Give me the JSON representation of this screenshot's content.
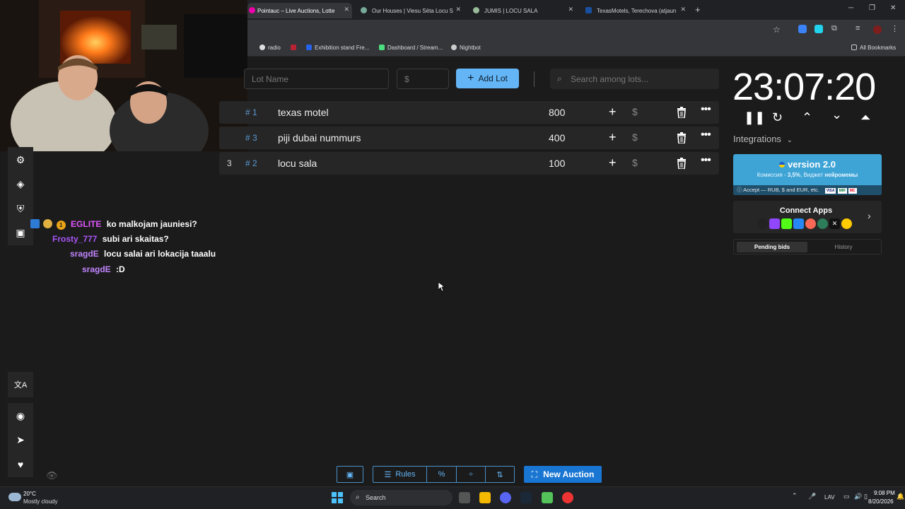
{
  "browser": {
    "tabs": [
      {
        "label": "Pointauc – Live Auctions, Lotte",
        "active": true
      },
      {
        "label": "Our Houses | Viesu Sēta Locu S",
        "active": false
      },
      {
        "label": "JUMIS | LOCU SALA",
        "active": false
      },
      {
        "label": "TexasMotels, Terechova (atjaun",
        "active": false
      }
    ],
    "bookmarks": [
      "radio",
      "Exhibition stand Fre...",
      "Dashboard / Stream...",
      "Nightbot"
    ],
    "all_bookmarks": "All Bookmarks",
    "new_tab": "+",
    "window_controls": {
      "min": "─",
      "max": "❐",
      "close": "✕"
    }
  },
  "lot_form": {
    "name_placeholder": "Lot Name",
    "amount_placeholder": "$",
    "add_label": "Add Lot",
    "search_placeholder": "Search among lots..."
  },
  "lots": [
    {
      "position": "",
      "id": "1",
      "name": "texas motel",
      "amount": "800"
    },
    {
      "position": "",
      "id": "3",
      "name": "piji dubai nummurs",
      "amount": "400"
    },
    {
      "position": "3",
      "id": "2",
      "name": "locu sala",
      "amount": "100"
    }
  ],
  "chat": [
    {
      "user": "EGLITE",
      "color": "#e056fd",
      "message": "ko malkojam jauniesi?",
      "badge": "1"
    },
    {
      "user": "Frosty_777",
      "color": "#a855f7",
      "message": "subi ari skaitas?"
    },
    {
      "user": "sragdE",
      "color": "#c084fc",
      "message": "locu salai ari lokacija taaalu"
    },
    {
      "user": "sragdE",
      "color": "#c084fc",
      "message": ":D"
    }
  ],
  "timer": {
    "value": "23:07:20"
  },
  "integrations": {
    "label": "Integrations"
  },
  "version_banner": {
    "title": "version 2.0",
    "subtitle_prefix": "Комиссия - ",
    "subtitle_pct": "3,5%",
    "subtitle_mid": ", Виджет ",
    "subtitle_bold": "нейромемы",
    "accept_text": "Accept — RUB, $ and EUR, etc.",
    "cards": [
      "VISA",
      "MIR",
      "MC"
    ]
  },
  "connect_apps": {
    "title": "Connect Apps",
    "apps": [
      "DA",
      "Twitch",
      "Kick",
      "VK",
      "Patreon",
      "Boosty",
      "X",
      "Yandex"
    ]
  },
  "bid_tabs": {
    "pending": "Pending bids",
    "history": "History"
  },
  "toolbar": {
    "rules_label": "Rules",
    "new_auction_label": "New Auction"
  },
  "taskbar": {
    "weather_temp": "20°C",
    "weather_desc": "Mostly cloudy",
    "search_label": "Search",
    "lang": "LAV",
    "time": "9:08 PM",
    "date": "8/20/2026"
  },
  "colors": {
    "accent": "#64b5f6",
    "accent_dark": "#1976d2",
    "banner": "#3ea4d6",
    "row_bg": "#262626"
  }
}
